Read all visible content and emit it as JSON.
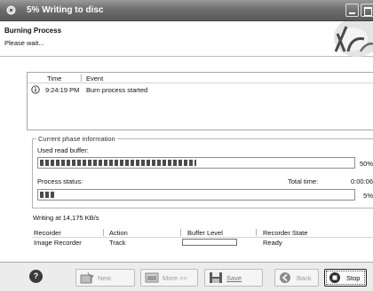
{
  "window": {
    "title": "5% Writing to disc"
  },
  "header": {
    "title": "Burning Process",
    "subtitle": "Please wait..."
  },
  "log": {
    "columns": [
      "Time",
      "Event"
    ],
    "rows": [
      {
        "time": "9:24:19 PM",
        "event": "Burn process started",
        "icon": "info-icon"
      }
    ]
  },
  "phase": {
    "legend": "Current phase information",
    "read_buffer_label": "Used read buffer:",
    "read_buffer_fraction": 0.5,
    "read_buffer_text": "50%",
    "process_status_label": "Process status:",
    "total_time_label": "Total time:",
    "total_time_value": "0:00:06",
    "process_fraction": 0.05,
    "process_text": "5%"
  },
  "speed_text": "Writing at 14,175 KB/s",
  "recorders": {
    "columns": [
      "Recorder",
      "Action",
      "Buffer Level",
      "Recorder State"
    ],
    "rows": [
      {
        "recorder": "Image Recorder",
        "action": "Track",
        "buffer_level": 0,
        "state": "Ready"
      }
    ]
  },
  "buttons": {
    "help": "?",
    "new": "New",
    "more": "More >>",
    "save": "Save",
    "back": "Back",
    "stop": "Stop"
  },
  "colors": {
    "titlebar": "#6e6e6e",
    "progress_fill": "#4b4b4b"
  }
}
